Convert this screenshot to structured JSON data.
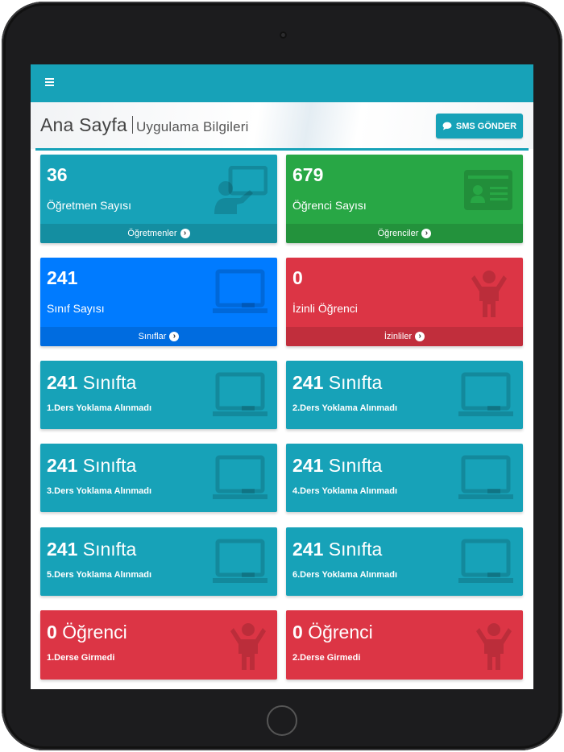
{
  "header": {
    "title": "Ana Sayfa",
    "subtitle": "Uygulama Bilgileri",
    "sms_button": "SMS GÖNDER"
  },
  "cards": {
    "teachers": {
      "count": "36",
      "label": "Öğretmen Sayısı",
      "link": "Öğretmenler",
      "color": "#17a2b8",
      "icon": "chalkboard-teacher-icon"
    },
    "students": {
      "count": "679",
      "label": "Öğrenci Sayısı",
      "link": "Öğrenciler",
      "color": "#28a745",
      "icon": "id-card-icon"
    },
    "classes": {
      "count": "241",
      "label": "Sınıf Sayısı",
      "link": "Sınıflar",
      "color": "#007bff",
      "icon": "chalkboard-icon"
    },
    "permitted": {
      "count": "0",
      "label": "İzinli Öğrenci",
      "link": "İzinliler",
      "color": "#dc3545",
      "icon": "child-icon"
    }
  },
  "stats": [
    {
      "count": "241",
      "unit": "Sınıfta",
      "label": "1.Ders Yoklama Alınmadı",
      "color": "#17a2b8",
      "icon": "chalkboard-icon"
    },
    {
      "count": "241",
      "unit": "Sınıfta",
      "label": "2.Ders Yoklama Alınmadı",
      "color": "#17a2b8",
      "icon": "chalkboard-icon"
    },
    {
      "count": "241",
      "unit": "Sınıfta",
      "label": "3.Ders Yoklama Alınmadı",
      "color": "#17a2b8",
      "icon": "chalkboard-icon"
    },
    {
      "count": "241",
      "unit": "Sınıfta",
      "label": "4.Ders Yoklama Alınmadı",
      "color": "#17a2b8",
      "icon": "chalkboard-icon"
    },
    {
      "count": "241",
      "unit": "Sınıfta",
      "label": "5.Ders Yoklama Alınmadı",
      "color": "#17a2b8",
      "icon": "chalkboard-icon"
    },
    {
      "count": "241",
      "unit": "Sınıfta",
      "label": "6.Ders Yoklama Alınmadı",
      "color": "#17a2b8",
      "icon": "chalkboard-icon"
    },
    {
      "count": "0",
      "unit": "Öğrenci",
      "label": "1.Derse Girmedi",
      "color": "#dc3545",
      "icon": "child-icon"
    },
    {
      "count": "0",
      "unit": "Öğrenci",
      "label": "2.Derse Girmedi",
      "color": "#dc3545",
      "icon": "child-icon"
    }
  ]
}
